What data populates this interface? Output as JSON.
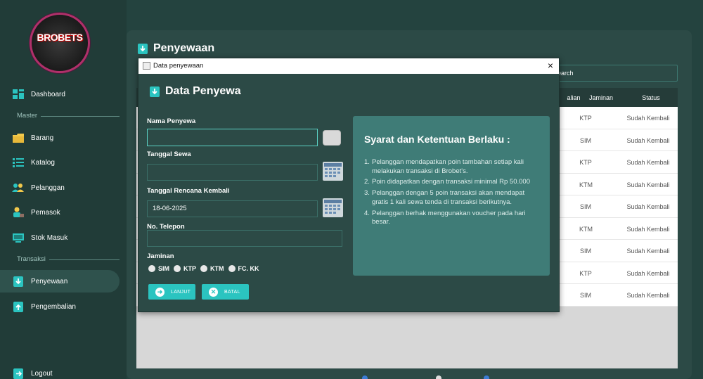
{
  "sidebar": {
    "logo_text": "BROBETS",
    "items": [
      {
        "label": "Dashboard"
      },
      {
        "label": "Barang"
      },
      {
        "label": "Katalog"
      },
      {
        "label": "Pelanggan"
      },
      {
        "label": "Pemasok"
      },
      {
        "label": "Stok Masuk"
      },
      {
        "label": "Penyewaan"
      },
      {
        "label": "Pengembalian"
      },
      {
        "label": "Logout"
      }
    ],
    "sections": {
      "master": "Master",
      "transaksi": "Transaksi"
    }
  },
  "main": {
    "title": "Penyewaan",
    "search_text": "earch",
    "table": {
      "headers": {
        "partial": "alian",
        "jaminan": "Jaminan",
        "status": "Status"
      },
      "rows": [
        {
          "jaminan": "KTP",
          "status": "Sudah Kembali"
        },
        {
          "jaminan": "SIM",
          "status": "Sudah Kembali"
        },
        {
          "jaminan": "KTP",
          "status": "Sudah Kembali"
        },
        {
          "jaminan": "KTM",
          "status": "Sudah Kembali"
        },
        {
          "jaminan": "SIM",
          "status": "Sudah Kembali"
        },
        {
          "jaminan": "KTM",
          "status": "Sudah Kembali"
        },
        {
          "jaminan": "SIM",
          "status": "Sudah Kembali"
        },
        {
          "jaminan": "KTP",
          "status": "Sudah Kembali"
        },
        {
          "jaminan": "SIM",
          "status": "Sudah Kembali"
        }
      ]
    }
  },
  "dialog": {
    "window_title": "Data penyewaan",
    "close": "×",
    "heading": "Data Penyewa",
    "fields": {
      "nama_label": "Nama Penyewa",
      "nama_value": "",
      "tanggal_sewa_label": "Tanggal Sewa",
      "tanggal_sewa_value": "",
      "tanggal_kembali_label": "Tanggal Rencana Kembali",
      "tanggal_kembali_value": "18-06-2025",
      "telepon_label": "No. Telepon",
      "telepon_value": "",
      "jaminan_label": "Jaminan"
    },
    "jaminan_options": [
      "SIM",
      "KTP",
      "KTM",
      "FC. KK"
    ],
    "buttons": {
      "lanjut": "LANJUT",
      "batal": "BATAL"
    },
    "terms": {
      "title": "Syarat dan Ketentuan Berlaku :",
      "items": [
        {
          "n": "1.",
          "text": "Pelanggan mendapatkan poin tambahan setiap kali melakukan transaksi di Brobet's."
        },
        {
          "n": "2.",
          "text": "Poin didapatkan dengan transaksi minimal Rp 50.000"
        },
        {
          "n": "3.",
          "text": "Pelanggan dengan 5 poin transaksi akan mendapat gratis 1 kali sewa tenda di transaksi berikutnya."
        },
        {
          "n": "4.",
          "text": "Pelanggan berhak menggunakan voucher pada hari besar."
        }
      ]
    }
  },
  "colors": {
    "accent": "#2bc4c0",
    "sidebar_bg": "#213c38",
    "panel_bg": "#2c4a46",
    "terms_bg": "#3f7c77"
  }
}
